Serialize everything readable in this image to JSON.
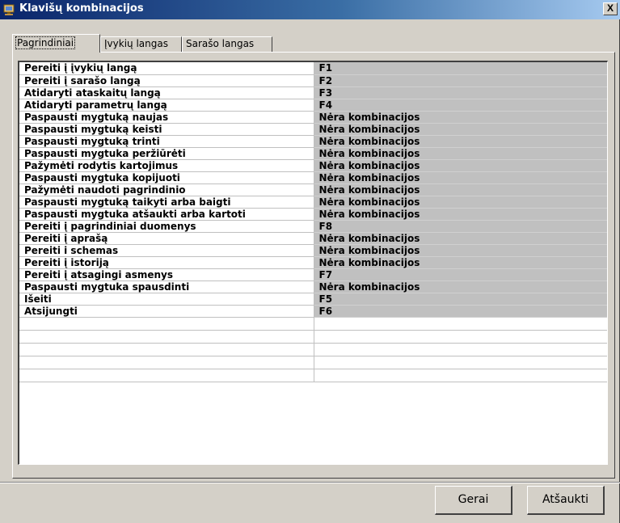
{
  "window": {
    "title": "Klavišų kombinacijos",
    "close_label": "X",
    "icon": "app-icon"
  },
  "tabs": [
    {
      "label": "Pagrindiniai",
      "active": true
    },
    {
      "label": "Įvykių langas",
      "active": false
    },
    {
      "label": "Sarašo langas",
      "active": false
    }
  ],
  "shortcuts": [
    {
      "action": "Pereiti į įvykių langą",
      "key": "F1"
    },
    {
      "action": "Pereiti į sarašo langą",
      "key": "F2"
    },
    {
      "action": "Atidaryti ataskaitų langą",
      "key": "F3"
    },
    {
      "action": "Atidaryti parametrų langą",
      "key": "F4"
    },
    {
      "action": "Paspausti mygtuką naujas",
      "key": "Nėra kombinacijos"
    },
    {
      "action": "Paspausti mygtuką keisti",
      "key": "Nėra kombinacijos"
    },
    {
      "action": "Paspausti mygtuką trinti",
      "key": "Nėra kombinacijos"
    },
    {
      "action": "Paspausti mygtuka peržiūrėti",
      "key": "Nėra kombinacijos"
    },
    {
      "action": "Pažymėti rodytis kartojimus",
      "key": "Nėra kombinacijos"
    },
    {
      "action": "Paspausti mygtuka kopijuoti",
      "key": "Nėra kombinacijos"
    },
    {
      "action": "Pažymėti naudoti pagrindinio",
      "key": "Nėra kombinacijos"
    },
    {
      "action": "Paspausti mygtuką taikyti arba baigti",
      "key": "Nėra kombinacijos"
    },
    {
      "action": "Paspausti mygtuka atšaukti arba kartoti",
      "key": "Nėra kombinacijos"
    },
    {
      "action": "Pereiti į pagrindiniai duomenys",
      "key": "F8"
    },
    {
      "action": "Pereiti į aprašą",
      "key": "Nėra kombinacijos"
    },
    {
      "action": "Pereiti i schemas",
      "key": "Nėra kombinacijos"
    },
    {
      "action": "Pereiti į istoriją",
      "key": "Nėra kombinacijos"
    },
    {
      "action": "Pereiti į atsagingi asmenys",
      "key": "F7"
    },
    {
      "action": "Paspausti mygtuka spausdinti",
      "key": "Nėra kombinacijos"
    },
    {
      "action": "Išeiti",
      "key": "F5"
    },
    {
      "action": "Atsijungti",
      "key": "F6"
    }
  ],
  "buttons": {
    "ok_label": "Gerai",
    "cancel_label": "Atšaukti"
  },
  "colors": {
    "titlebar_start": "#0a246a",
    "titlebar_end": "#a6caf0",
    "dialog_face": "#d4d0c8",
    "key_cell": "#c0c0c0"
  }
}
